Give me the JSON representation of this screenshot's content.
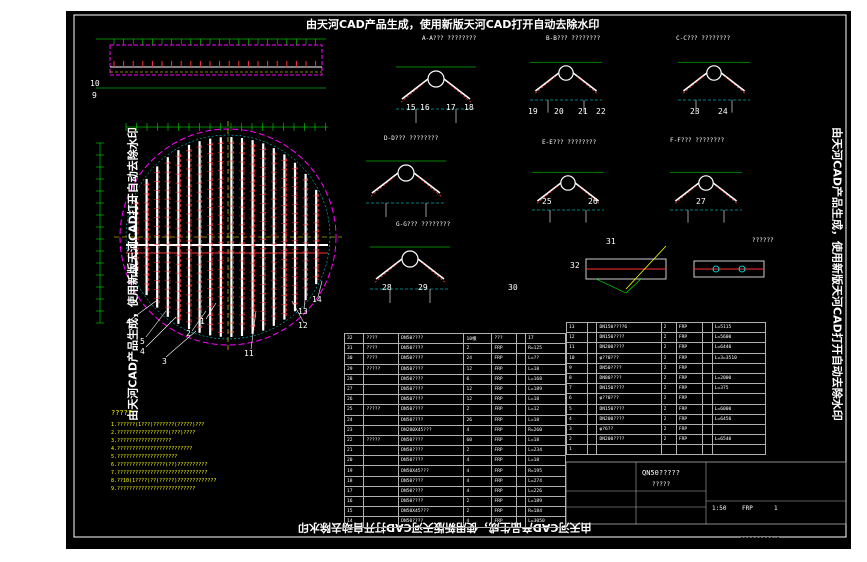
{
  "banner_text": "由天河CAD产品生成，使用新版天河CAD打开自动去除水印",
  "bottom_right_caption": "?????????!?",
  "notes": {
    "title": "?????",
    "lines": [
      "1.??????(1???)???????(?????)???",
      "2.?????????????????(???)????",
      "3.??????????????????",
      "4.?????????????????????????",
      "5.????????????????????",
      "6.????????????????(??)??????????",
      "7.??????????????????????????????",
      "8.??10(1????)??(?????)?????????????",
      "9.??????????????????????????"
    ]
  },
  "section_labels": {
    "A": "A-A??? ????????",
    "B": "B-B??? ????????",
    "C": "C-C??? ????????",
    "D": "D-D??? ????????",
    "E": "E-E??? ????????",
    "F": "F-F??? ????????",
    "G": "G-G??? ????????",
    "H": "??????"
  },
  "callouts": {
    "c1": "1",
    "c2": "2",
    "c3": "3",
    "c4": "4",
    "c5": "5",
    "c6": "6",
    "c9": "9",
    "c10": "10",
    "c11": "11",
    "c12": "12",
    "c13": "13",
    "c14": "14",
    "c15": "15",
    "c16": "16",
    "c17": "17",
    "c18": "18",
    "c19": "19",
    "c20": "20",
    "c21": "21",
    "c22": "22",
    "c23": "23",
    "c24": "24",
    "c25": "25",
    "c26": "26",
    "c27": "27",
    "c28": "28",
    "c29": "29",
    "c30": "30",
    "c31": "31",
    "c32": "32"
  },
  "bom_left": [
    [
      "32",
      "????",
      "DN50????",
      "10根",
      "???",
      "",
      "17"
    ],
    [
      "31",
      "????",
      "DN50????",
      "2",
      "FRP",
      "",
      "R=125"
    ],
    [
      "30",
      "????",
      "DN50????",
      "24",
      "FRP",
      "",
      "L=??"
    ],
    [
      "29",
      "?????",
      "DN50????",
      "12",
      "FRP",
      "",
      "L=18"
    ],
    [
      "28",
      "",
      "DN50????",
      "6",
      "FRP",
      "",
      "L=168"
    ],
    [
      "27",
      "",
      "DN50????",
      "12",
      "FRP",
      "",
      "L=189"
    ],
    [
      "26",
      "",
      "DN50????",
      "12",
      "FRP",
      "",
      "L=18"
    ],
    [
      "25",
      "?????",
      "DN50????",
      "2",
      "FRP",
      "",
      "L=12"
    ],
    [
      "24",
      "",
      "DN50????",
      "26",
      "FRP",
      "",
      "L=18"
    ],
    [
      "23",
      "",
      "DN200X45???",
      "4",
      "FRP",
      "",
      "R=260"
    ],
    [
      "22",
      "?????",
      "DN50????",
      "60",
      "FRP",
      "",
      "L=18"
    ],
    [
      "21",
      "",
      "DN50????",
      "2",
      "FRP",
      "",
      "L=234"
    ],
    [
      "20",
      "",
      "DN50????",
      "4",
      "FRP",
      "",
      "L=18"
    ],
    [
      "19",
      "",
      "DN50X45???",
      "4",
      "FRP",
      "",
      "R=195"
    ],
    [
      "18",
      "",
      "DN50????",
      "4",
      "FRP",
      "",
      "L=274"
    ],
    [
      "17",
      "",
      "DN50????",
      "4",
      "FRP",
      "",
      "L=226"
    ],
    [
      "16",
      "",
      "DN50????",
      "2",
      "FRP",
      "",
      "L=189"
    ],
    [
      "15",
      "",
      "DN50X45???",
      "2",
      "FRP",
      "",
      "R=184"
    ],
    [
      "14",
      "",
      "DN50????",
      "4",
      "FRP",
      "",
      "L=3050"
    ]
  ],
  "bom_right": [
    [
      "13",
      "",
      "DN150????6",
      "2",
      "FRP",
      "",
      "L=5115"
    ],
    [
      "12",
      "",
      "DN150????",
      "2",
      "FRP",
      "",
      "L=5600"
    ],
    [
      "11",
      "",
      "DN200????",
      "2",
      "FRP",
      "",
      "L=6440"
    ],
    [
      "10",
      "",
      "φ??0???",
      "2",
      "FRP",
      "",
      "L=3=3510"
    ],
    [
      "9",
      "",
      "DN50????",
      "2",
      "FRP",
      "",
      ""
    ],
    [
      "8",
      "",
      "DN80????",
      "2",
      "FRP",
      "",
      "L=2000"
    ],
    [
      "7",
      "",
      "DN150????",
      "2",
      "FRP",
      "",
      "L=375"
    ],
    [
      "6",
      "",
      "φ??0???",
      "2",
      "FRP",
      "",
      ""
    ],
    [
      "5",
      "",
      "DN150????",
      "2",
      "FRP",
      "",
      "L=6000"
    ],
    [
      "4",
      "",
      "DN200????",
      "2",
      "FRP",
      "",
      "L=6450"
    ],
    [
      "3",
      "",
      "φ?6??",
      "2",
      "FRP",
      "",
      ""
    ],
    [
      "2",
      "",
      "DN200????",
      "2",
      "FRP",
      "",
      "L=6540"
    ],
    [
      "1",
      "",
      "",
      "",
      "",
      "",
      ""
    ]
  ],
  "bom_header": [
    "??",
    "??",
    "?",
    "??",
    "??",
    "??",
    "?"
  ],
  "title_block": {
    "drawing_name": "QN50?????",
    "subtitle": "?????",
    "material": "FRP",
    "sheet": "1",
    "scale": "1:50"
  }
}
